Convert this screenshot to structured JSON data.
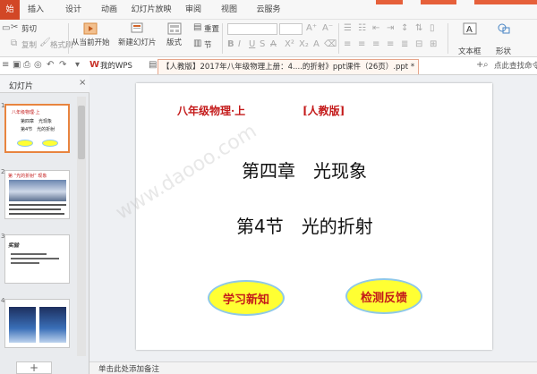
{
  "menu": {
    "tabs": [
      {
        "label": "始"
      },
      {
        "label": "插入"
      },
      {
        "label": "设计"
      },
      {
        "label": "动画"
      },
      {
        "label": "幻灯片放映"
      },
      {
        "label": "审阅"
      },
      {
        "label": "视图"
      },
      {
        "label": "云服务"
      }
    ]
  },
  "ribbon": {
    "cut": "剪切",
    "copy": "复制",
    "format_painter": "格式刷",
    "from_current": "从当前开始",
    "new_slide": "新建幻灯片",
    "layout": "版式",
    "reset": "重置",
    "section": "节",
    "textbox": "文本框",
    "shapes": "形状"
  },
  "quickbar": {
    "home_tab": "我的WPS",
    "doc_tab": "【人教版】2017年八年级物理上册：4....的折射》ppt课件（26页）.ppt *",
    "add_tab": "+",
    "search": "点此查找命令"
  },
  "left_panel": {
    "title": "幻灯片",
    "close": "×",
    "add": "+",
    "thumb_numbers": [
      "1",
      "2",
      "3",
      "4"
    ]
  },
  "thumb1": {
    "line1": "八年级物理·上",
    "line2": "第四章　光现象",
    "line3": "第4节　光的折射"
  },
  "thumb2": {
    "title": "第 “光的折射” 现象"
  },
  "thumb3": {
    "title": "实验"
  },
  "slide": {
    "grade": "八年级物理·上",
    "edition": "[人教版]",
    "chapter": "第四章　光现象",
    "section": "第4节　光的折射",
    "btn_learn": "学习新知",
    "btn_test": "检测反馈"
  },
  "status": {
    "notes": "单击此处添加备注"
  },
  "watermark": "www.daooo.com",
  "colors": {
    "accent": "#d24726",
    "slide_title_red": "#c41a1a",
    "oval_fill": "#ffff33",
    "oval_border": "#8ec8e8"
  }
}
